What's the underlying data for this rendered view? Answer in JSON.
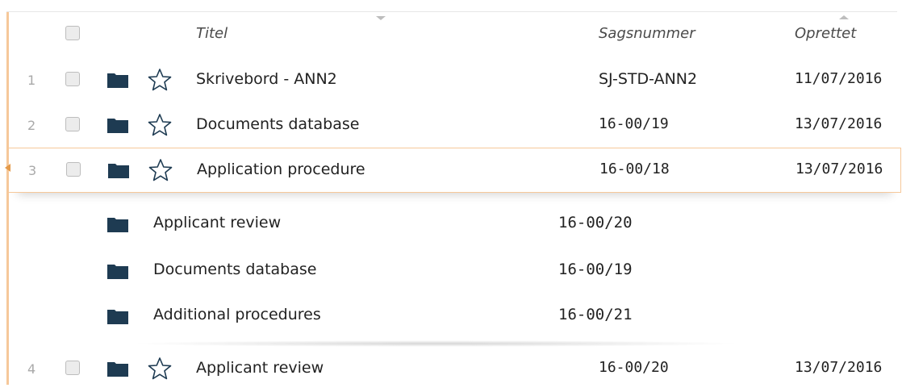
{
  "header": {
    "titel": "Titel",
    "sagsnummer": "Sagsnummer",
    "oprettet": "Oprettet"
  },
  "rows": [
    {
      "num": "1",
      "title": "Skrivebord - ANN2",
      "case": "SJ-STD-ANN2",
      "created": "11/07/2016"
    },
    {
      "num": "2",
      "title": "Documents database",
      "case": "16-00/19",
      "created": "13/07/2016"
    },
    {
      "num": "3",
      "title": "Application procedure",
      "case": "16-00/18",
      "created": "13/07/2016"
    },
    {
      "num": "4",
      "title": "Applicant review",
      "case": "16-00/20",
      "created": "13/07/2016"
    }
  ],
  "subrows": [
    {
      "title": "Applicant review",
      "case": "16-00/20"
    },
    {
      "title": "Documents database",
      "case": "16-00/19"
    },
    {
      "title": "Additional procedures",
      "case": "16-00/21"
    }
  ],
  "colors": {
    "accent": "#f6c89a",
    "folder": "#1e3b52",
    "selection_marker": "#e49a4a"
  },
  "icons": {
    "folder": "folder-icon",
    "star": "star-outline-icon",
    "sort": "sort-arrow-icon"
  }
}
